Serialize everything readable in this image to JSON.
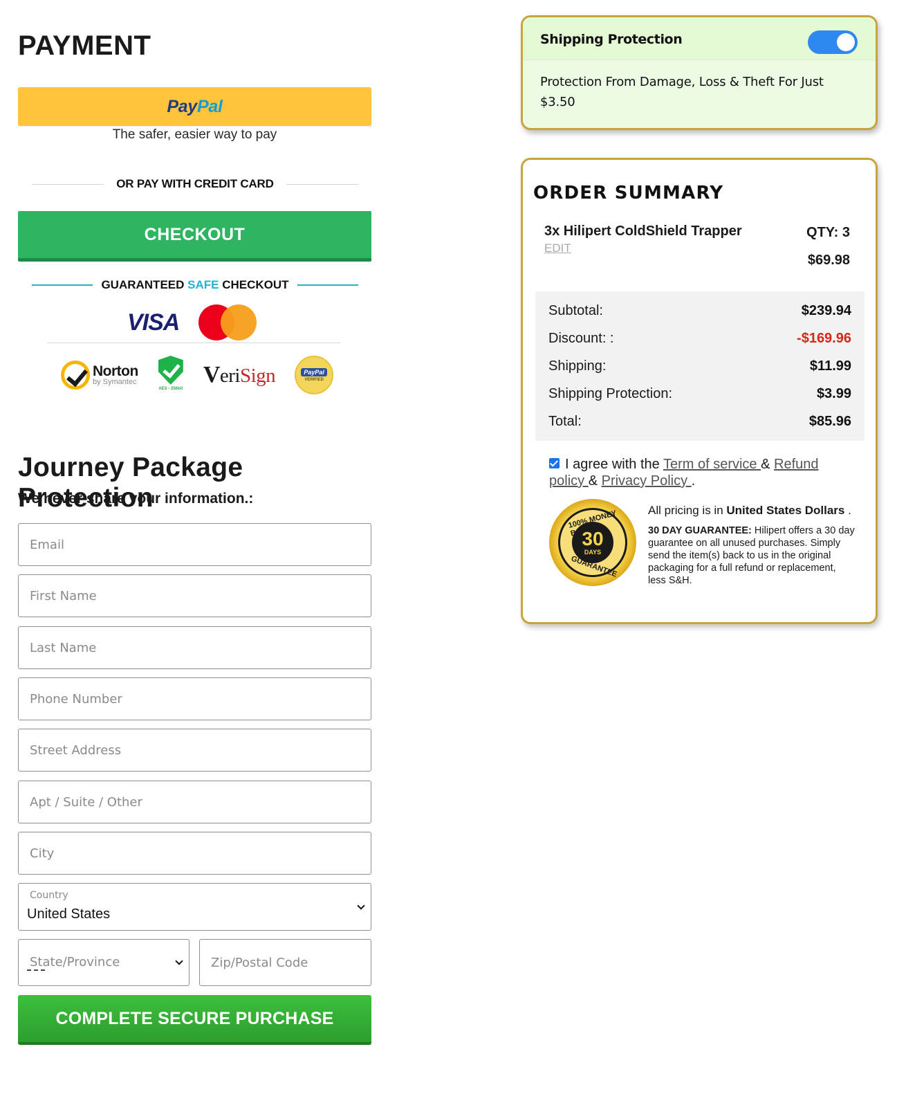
{
  "payment": {
    "title": "PAYMENT",
    "paypal_logo_1": "Pay",
    "paypal_logo_2": "Pal",
    "paypal_tagline": "The safer, easier way to pay",
    "or_text": "OR PAY WITH CREDIT CARD",
    "checkout_label": "CHECKOUT",
    "guaranteed_1": "GUARANTEED",
    "guaranteed_safe": "SAFE",
    "guaranteed_2": "CHECKOUT",
    "visa": "VISA",
    "norton_1": "Norton",
    "norton_2": "by Symantec",
    "shield_label": "AES - 256bit",
    "verisign_v": "V",
    "verisign_eri": "eri",
    "verisign_sign": "Sign",
    "paypal_badge_1": "PayPal",
    "paypal_badge_2": "VERIFIED"
  },
  "form": {
    "title": "Journey Package Protection",
    "subtitle": "We never share your information.:",
    "email_placeholder": "Email",
    "first_name_placeholder": "First Name",
    "last_name_placeholder": "Last Name",
    "phone_placeholder": "Phone Number",
    "street_placeholder": "Street Address",
    "apt_placeholder": "Apt / Suite / Other",
    "city_placeholder": "City",
    "country_label": "Country",
    "country_value": "United States",
    "state_value": "State/Province",
    "zip_placeholder": "Zip/Postal Code",
    "purchase_label": "COMPLETE SECURE PURCHASE"
  },
  "shipping_protection": {
    "title": "Shipping Protection",
    "enabled": true,
    "description": "Protection From Damage, Loss & Theft For Just $3.50"
  },
  "order_summary": {
    "title": "ORDER SUMMARY",
    "item_name": "3x Hilipert ColdShield Trapper",
    "item_qty": "QTY: 3",
    "edit_label": "EDIT",
    "item_price": "$69.98",
    "subtotal_label": "Subtotal:",
    "subtotal_value": "$239.94",
    "discount_label": "Discount: :",
    "discount_value": "-$169.96",
    "shipping_label": "Shipping:",
    "shipping_value": "$11.99",
    "protection_label": "Shipping Protection:",
    "protection_value": "$3.99",
    "total_label": "Total:",
    "total_value": "$85.96",
    "agree_checked": true,
    "agree_text": "I agree with the",
    "terms_link": "Term of service ",
    "amp_1": "& ",
    "refund_link": "Refund policy ",
    "amp_2": "& ",
    "privacy_link": "Privacy Policy ",
    "period": ".",
    "seal_number": "30",
    "seal_days": "DAYS",
    "seal_top": "100% MONEY BACK",
    "seal_bottom": "GUARANTEE",
    "pricing_prefix": "All pricing is in",
    "pricing_currency": "United States Dollars",
    "pricing_suffix": ".",
    "guarantee_bold": "30 DAY GUARANTEE:",
    "guarantee_body": "Hilipert offers a 30 day guarantee on all unused purchases. Simply send the item(s) back to us in the original packaging for a full refund or replacement, less S&H."
  },
  "colors": {
    "paypal_yellow": "#ffc439",
    "checkout_green": "#2db562",
    "purchase_green": "#2d9e2d",
    "gold_border": "#c9a33b",
    "discount_red": "#d9261c",
    "toggle_blue": "#2f87f0"
  }
}
